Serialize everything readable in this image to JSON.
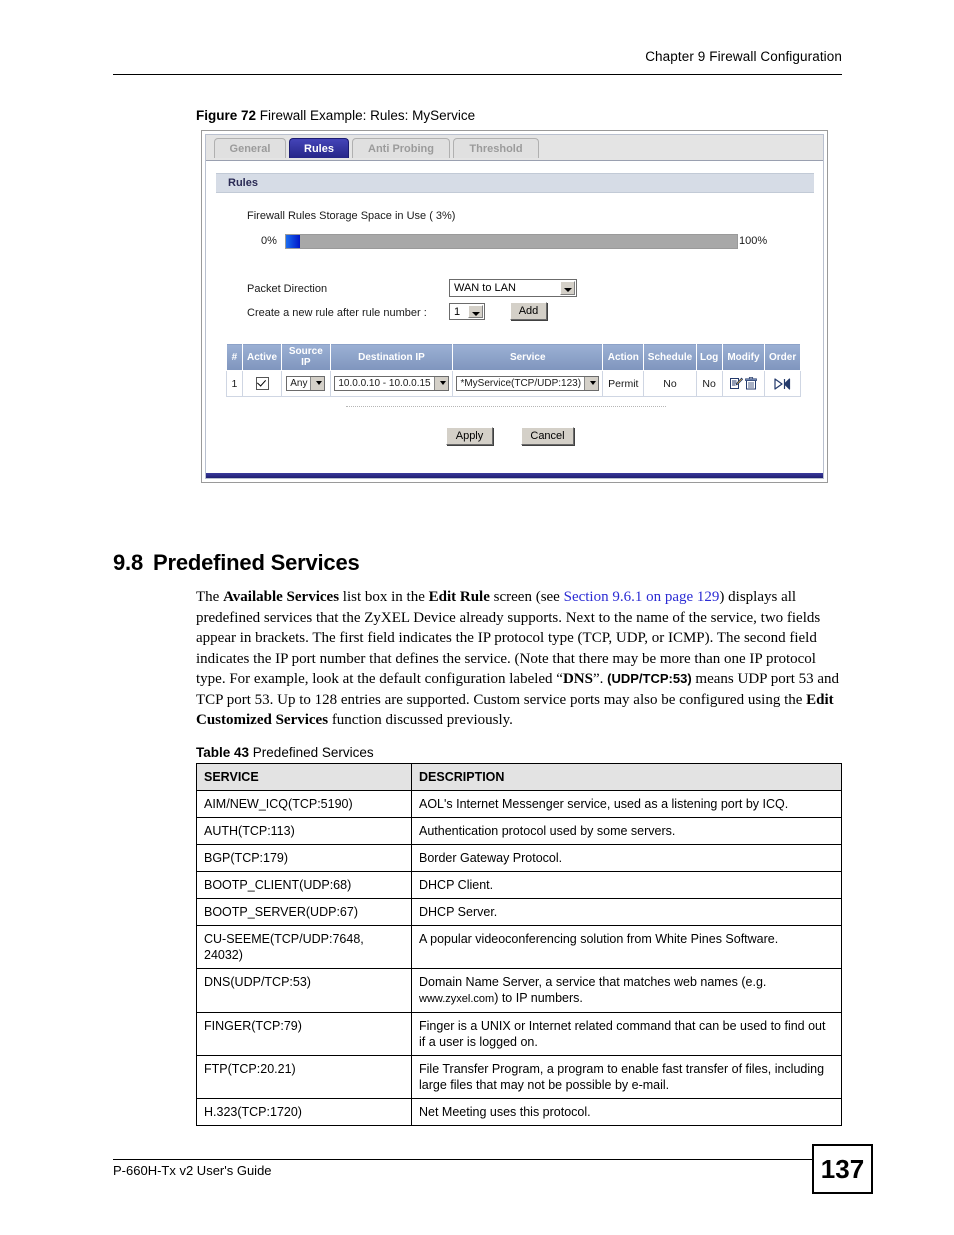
{
  "page": {
    "chapter_header": "Chapter 9 Firewall Configuration",
    "footer_guide": "P-660H-Tx v2 User's Guide",
    "page_number": "137"
  },
  "figure": {
    "label": "Figure 72",
    "caption": "Firewall Example: Rules: MyService",
    "tabs": [
      {
        "label": "General",
        "active": false
      },
      {
        "label": "Rules",
        "active": true
      },
      {
        "label": "Anti Probing",
        "active": false
      },
      {
        "label": "Threshold",
        "active": false
      }
    ],
    "panel_title": "Rules",
    "storage": {
      "label": "Firewall Rules Storage Space in Use  ( 3%)",
      "min_label": "0%",
      "max_label": "100%",
      "percent": 3,
      "fill_color": "#0a2fe8",
      "track_color": "#a8a8a8"
    },
    "form": {
      "packet_direction_label": "Packet Direction",
      "packet_direction_value": "WAN to LAN",
      "new_rule_label": "Create a new rule after rule number :",
      "new_rule_value": "1",
      "add_button": "Add"
    },
    "rules_table": {
      "headers": [
        "#",
        "Active",
        "Source IP",
        "Destination IP",
        "Service",
        "Action",
        "Schedule",
        "Log",
        "Modify",
        "Order"
      ],
      "rows": [
        {
          "index": "1",
          "active": true,
          "source_ip": "Any",
          "destination_ip": "10.0.0.10 - 10.0.0.15",
          "service": "*MyService(TCP/UDP:123)",
          "action": "Permit",
          "schedule": "No",
          "log": "No"
        }
      ]
    },
    "apply_button": "Apply",
    "cancel_button": "Cancel"
  },
  "section": {
    "number": "9.8",
    "title": "Predefined Services",
    "paragraph": {
      "p1": "The ",
      "b1": "Available Services",
      "p2": " list box in the ",
      "b2": "Edit Rule",
      "p3": " screen (see ",
      "link": "Section 9.6.1 on page 129",
      "p4": ") displays all predefined services that the ZyXEL Device already supports. Next to the name of the service, two fields appear in brackets. The first field indicates the IP protocol type (TCP, UDP, or ICMP). The second field indicates the IP port number that defines the service. (Note that there may be more than one IP protocol type. For example, look at the default configuration labeled “",
      "b3": "DNS",
      "p5": "”. ",
      "b4": "(UDP/TCP:53)",
      "p6": " means UDP port 53 and TCP port 53. Up to 128 entries are supported. Custom service ports may also be configured using the ",
      "b5": "Edit Customized Services",
      "p7": " function discussed previously."
    }
  },
  "table43": {
    "label": "Table 43",
    "caption": "Predefined Services",
    "headers": [
      "SERVICE",
      "DESCRIPTION"
    ],
    "rows": [
      {
        "service": "AIM/NEW_ICQ(TCP:5190)",
        "description": "AOL's Internet Messenger service, used as a listening port by ICQ."
      },
      {
        "service": "AUTH(TCP:113)",
        "description": "Authentication protocol used by some servers."
      },
      {
        "service": "BGP(TCP:179)",
        "description": "Border Gateway Protocol."
      },
      {
        "service": "BOOTP_CLIENT(UDP:68)",
        "description": "DHCP Client."
      },
      {
        "service": "BOOTP_SERVER(UDP:67)",
        "description": "DHCP Server."
      },
      {
        "service": "CU-SEEME(TCP/UDP:7648, 24032)",
        "description": "A popular videoconferencing solution from White Pines Software."
      },
      {
        "service": "DNS(UDP/TCP:53)",
        "description_part1": "Domain Name Server, a service that matches web names (e.g. ",
        "description_url": "www.zyxel.com",
        "description_part2": ") to IP numbers."
      },
      {
        "service": "FINGER(TCP:79)",
        "description": "Finger is a UNIX or Internet related command that can be used to find out if a user is logged on."
      },
      {
        "service": "FTP(TCP:20.21)",
        "description": "File Transfer Program, a program to enable fast transfer of files, including large files that may not be possible by e-mail."
      },
      {
        "service": "H.323(TCP:1720)",
        "description": "Net Meeting uses this protocol."
      }
    ]
  }
}
